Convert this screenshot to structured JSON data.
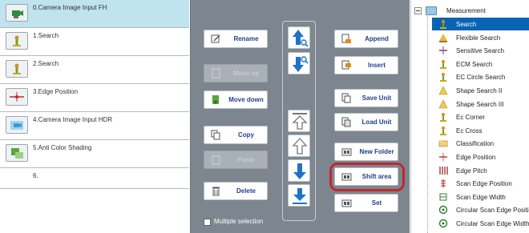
{
  "unit_list": [
    {
      "label": "0.Camera Image Input FH",
      "icon": "camera-icon",
      "selected": true
    },
    {
      "label": "1.Search",
      "icon": "search-unit-icon",
      "selected": false
    },
    {
      "label": "2.Search",
      "icon": "search-unit-icon",
      "selected": false
    },
    {
      "label": "3.Edge Position",
      "icon": "edge-position-icon",
      "selected": false
    },
    {
      "label": "4.Camera Image Input HDR",
      "icon": "camera-hdr-icon",
      "selected": false
    },
    {
      "label": "5.Anti Color Shading",
      "icon": "anti-color-shading-icon",
      "selected": false
    },
    {
      "label": "6.",
      "icon": "",
      "selected": false
    }
  ],
  "buttons": {
    "rename": "Rename",
    "move_up": "Move up",
    "move_down": "Move down",
    "copy": "Copy",
    "paste": "Paste",
    "delete": "Delete",
    "append": "Append",
    "insert": "Insert",
    "save_unit": "Save Unit",
    "load_unit": "Load Unit",
    "new_folder": "New Folder",
    "shift_area": "Shift area",
    "set": "Set",
    "multiple_selection": "Multiple selection"
  },
  "tree": {
    "root": "Measurement",
    "items": [
      {
        "label": "Search",
        "icon": "search-item-icon",
        "selected": true
      },
      {
        "label": "Flexible Search",
        "icon": "flexible-search-icon",
        "selected": false
      },
      {
        "label": "Sensitive Search",
        "icon": "sensitive-search-icon",
        "selected": false
      },
      {
        "label": "ECM Search",
        "icon": "ecm-search-icon",
        "selected": false
      },
      {
        "label": "EC Circle Search",
        "icon": "ec-circle-search-icon",
        "selected": false
      },
      {
        "label": "Shape Search II",
        "icon": "shape-search-icon",
        "selected": false
      },
      {
        "label": "Shape Search III",
        "icon": "shape-search-icon",
        "selected": false
      },
      {
        "label": "Ec Corner",
        "icon": "ec-corner-icon",
        "selected": false
      },
      {
        "label": "Ec Cross",
        "icon": "ec-cross-icon",
        "selected": false
      },
      {
        "label": "Classification",
        "icon": "classification-icon",
        "selected": false
      },
      {
        "label": "Edge Position",
        "icon": "edge-position-icon",
        "selected": false
      },
      {
        "label": "Edge Pitch",
        "icon": "edge-pitch-icon",
        "selected": false
      },
      {
        "label": "Scan Edge Position",
        "icon": "scan-edge-position-icon",
        "selected": false
      },
      {
        "label": "Scan Edge Width",
        "icon": "scan-edge-width-icon",
        "selected": false
      },
      {
        "label": "Circular Scan Edge Position",
        "icon": "circular-scan-icon",
        "selected": false
      },
      {
        "label": "Circular Scan Edge Width",
        "icon": "circular-scan-icon",
        "selected": false
      }
    ]
  },
  "colors": {
    "panel": "#7d868f",
    "selected_row": "#bfe3ef",
    "tree_selected": "#0a64b4",
    "button_text": "#1f3f8a",
    "arrow_blue": "#1e73c8",
    "highlight": "#c0282e"
  }
}
